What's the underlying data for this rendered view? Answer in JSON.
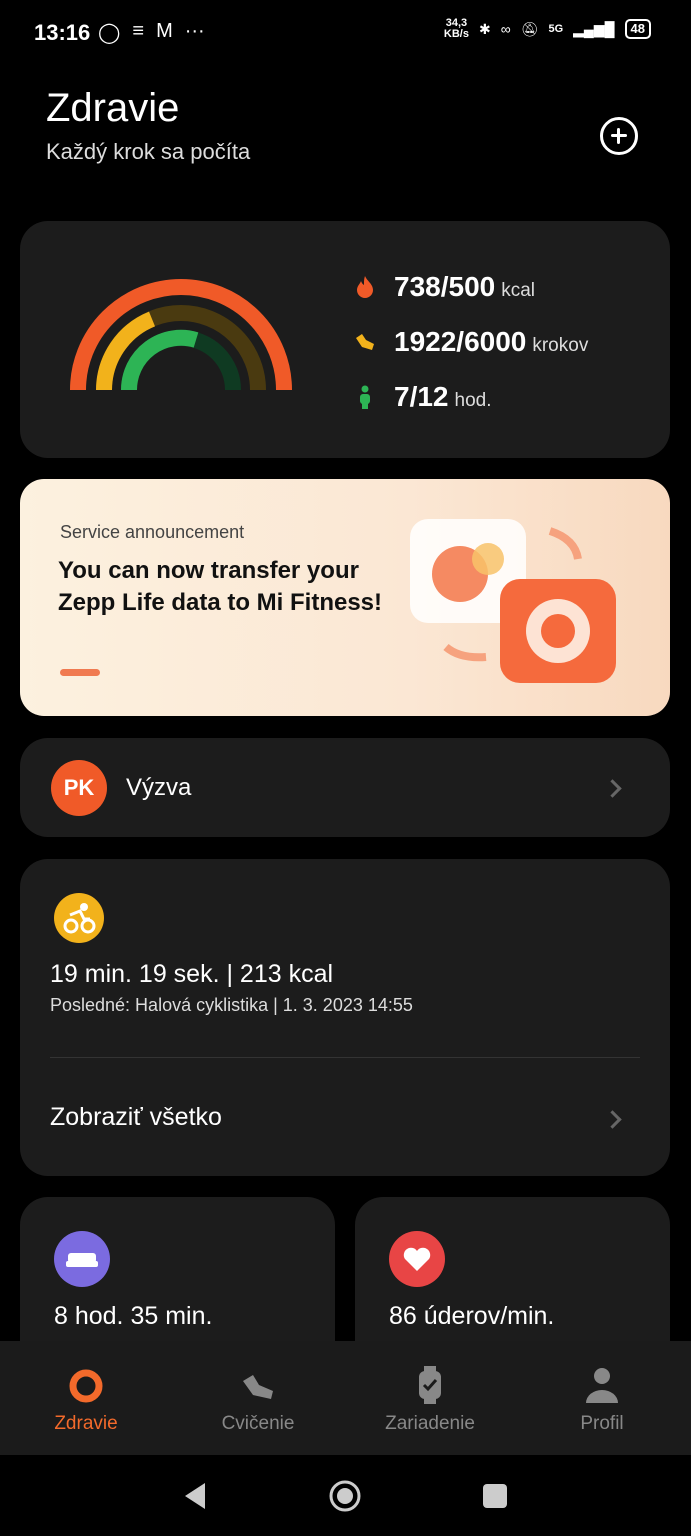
{
  "status_bar": {
    "time": "13:16",
    "speed_top": "34,3",
    "speed_bottom": "KB/s",
    "network": "5G",
    "battery": "48"
  },
  "header": {
    "title": "Zdravie",
    "subtitle": "Každý krok sa počíta"
  },
  "summary": {
    "calories": {
      "value": "738/500",
      "unit": "kcal",
      "progress": 1.0,
      "color": "#f05a28"
    },
    "steps": {
      "value": "1922/6000",
      "unit": "krokov",
      "progress": 0.32,
      "color": "#f2b21b"
    },
    "standing": {
      "value": "7/12",
      "unit": "hod.",
      "progress": 0.58,
      "color": "#2db455"
    }
  },
  "banner": {
    "small": "Service announcement",
    "big": "You can now transfer your Zepp Life data to Mi Fitness!"
  },
  "challenge": {
    "avatar": "PK",
    "label": "Výzva"
  },
  "workout": {
    "main": "19 min. 19 sek. | 213 kcal",
    "sub": "Posledné: Halová cyklistika | 1. 3. 2023 14:55",
    "view_all": "Zobraziť všetko"
  },
  "sleep": {
    "value": "8 hod. 35 min."
  },
  "heart": {
    "value": "86 úderov/min."
  },
  "nav": {
    "items": [
      {
        "label": "Zdravie",
        "icon": "health-ring-icon"
      },
      {
        "label": "Cvičenie",
        "icon": "shoe-icon"
      },
      {
        "label": "Zariadenie",
        "icon": "watch-icon"
      },
      {
        "label": "Profil",
        "icon": "person-icon"
      }
    ]
  },
  "colors": {
    "accent": "#f36a2b",
    "card": "#1c1c1c"
  }
}
